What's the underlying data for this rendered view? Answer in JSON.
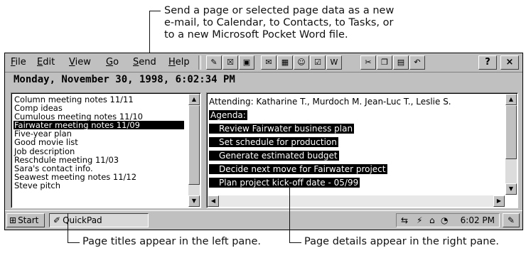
{
  "callouts": {
    "top_lines": [
      "Send a page or selected page data as a new",
      "e-mail, to Calendar, to Contacts, to Tasks, or",
      "to a new Microsoft Pocket Word file."
    ],
    "bottom_left": "Page titles appear in the left pane.",
    "bottom_right": "Page details appear in the right pane."
  },
  "menu": [
    "File",
    "Edit",
    "View",
    "Go",
    "Send",
    "Help"
  ],
  "toolbar": {
    "icons": [
      "new-note-icon",
      "delete-icon",
      "save-icon",
      "send-email-icon",
      "send-calendar-icon",
      "send-contacts-icon",
      "send-tasks-icon",
      "send-word-icon",
      "cut-icon",
      "copy-icon",
      "paste-icon",
      "undo-icon"
    ],
    "help_label": "?",
    "close_label": "×"
  },
  "dateline": "Monday, November 30, 1998, 6:02:34 PM",
  "pages": [
    "Column meeting notes 11/11",
    "Comp ideas",
    "Cumulous meeting notes 11/10",
    "Fairwater meeting notes 11/09",
    "Five-year plan",
    "Good movie list",
    "Job description",
    "Reschdule meeting 11/03",
    "Sara's contact info.",
    "Seawest meeting notes 11/12",
    "Steve pitch"
  ],
  "selected_index": 3,
  "details": {
    "attending": "Attending: Katharine T., Murdoch M. Jean-Luc T., Leslie S.",
    "agenda_label": "Agenda:",
    "items": [
      "Review Fairwater business plan",
      "Set schedule for production",
      "Generate estimated budget",
      "Decide next move for Fairwater project",
      "Plan project kick-off date - 05/99"
    ]
  },
  "taskbar": {
    "start_label": "Start",
    "task_label": "QuickPad",
    "clock": "6:02 PM"
  }
}
